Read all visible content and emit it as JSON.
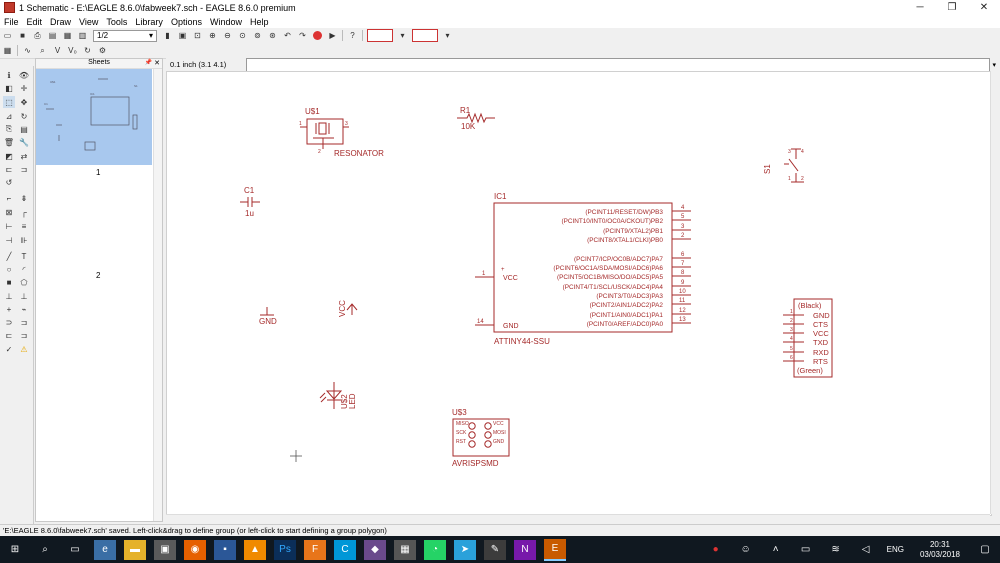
{
  "window": {
    "title": "1 Schematic - E:\\EAGLE 8.6.0\\fabweek7.sch - EAGLE 8.6.0 premium",
    "minimize": "─",
    "maximize": "❐",
    "close": "✕"
  },
  "menu": [
    "File",
    "Edit",
    "Draw",
    "View",
    "Tools",
    "Library",
    "Options",
    "Window",
    "Help"
  ],
  "toolbar": {
    "sheet_select": "1/2"
  },
  "sheets": {
    "header": "Sheets",
    "items": [
      "1",
      "2"
    ]
  },
  "command": {
    "coords": "0.1 inch (3.1 4.1)",
    "input_value": ""
  },
  "schematic": {
    "u1": {
      "name": "U$1",
      "value": "RESONATOR",
      "pin1": "1",
      "pin3": "3",
      "pin2": "2"
    },
    "r1": {
      "name": "R1",
      "value": "10K"
    },
    "s1": {
      "name": "S1",
      "pins": [
        "3",
        "4",
        "1",
        "2"
      ]
    },
    "c1": {
      "name": "C1",
      "value": "1u"
    },
    "ic1": {
      "name": "IC1",
      "value": "ATTINY44-SSU",
      "left_pins": [
        {
          "num": "1",
          "label": "VCC"
        },
        {
          "num": "14",
          "label": "GND"
        }
      ],
      "right_pins": [
        {
          "num": "4",
          "label": "(PCINT11/RESET/DW)PB3"
        },
        {
          "num": "5",
          "label": "(PCINT10/INT0/OC0A/CKOUT)PB2"
        },
        {
          "num": "3",
          "label": "(PCINT9/XTAL2)PB1"
        },
        {
          "num": "2",
          "label": "(PCINT8/XTAL1/CLKI)PB0"
        },
        {
          "num": "6",
          "label": "(PCINT7/ICP/OC0B/ADC7)PA7"
        },
        {
          "num": "7",
          "label": "(PCINT6/OC1A/SDA/MOSI/ADC6)PA6"
        },
        {
          "num": "8",
          "label": "(PCINT5/OC1B/MISO/DO/ADC5)PA5"
        },
        {
          "num": "9",
          "label": "(PCINT4/T1/SCL/USCK/ADC4)PA4"
        },
        {
          "num": "10",
          "label": "(PCINT3/T0/ADC3)PA3"
        },
        {
          "num": "11",
          "label": "(PCINT2/AIN1/ADC2)PA2"
        },
        {
          "num": "12",
          "label": "(PCINT1/AIN0/ADC1)PA1"
        },
        {
          "num": "13",
          "label": "(PCINT0/AREF/ADC0)PA0"
        }
      ]
    },
    "gnd": "GND",
    "vcc": "VCC",
    "ftdi": {
      "top": "(Black)",
      "pins": [
        "GND",
        "CTS",
        "VCC",
        "TXD",
        "RXD",
        "RTS"
      ],
      "pin_nums": [
        "1",
        "2",
        "3",
        "4",
        "5",
        "6"
      ],
      "bottom": "(Green)"
    },
    "u2": {
      "name": "U$2",
      "value": "LED"
    },
    "u3": {
      "name": "U$3",
      "value": "AVRISPSMD",
      "left_labels": [
        "MISO",
        "SCK",
        "RST"
      ],
      "right_labels": [
        "VCC",
        "MOSI",
        "GND"
      ]
    }
  },
  "status": "'E:\\EAGLE 8.6.0\\fabweek7.sch' saved. Left-click&drag to define group (or left-click to start defining a group polygon)",
  "taskbar": {
    "lang": "ENG",
    "time": "20:31",
    "date": "03/03/2018"
  },
  "colors": {
    "schematic": "#a52a2a",
    "selection": "#a8c8ee",
    "taskbar": "#101820"
  }
}
